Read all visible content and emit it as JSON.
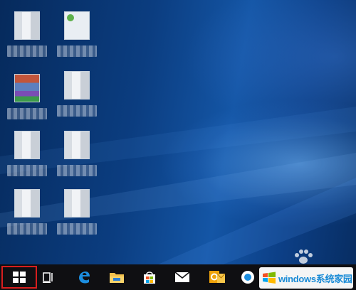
{
  "desktop": {
    "icons": [
      {
        "label": "",
        "style": "pix"
      },
      {
        "label": "",
        "style": "green"
      },
      {
        "label": "",
        "style": "colors"
      },
      {
        "label": "",
        "style": "pix"
      },
      {
        "label": "",
        "style": "pix"
      },
      {
        "label": "",
        "style": "pix"
      },
      {
        "label": "",
        "style": "pix"
      },
      {
        "label": "",
        "style": "pix"
      }
    ]
  },
  "taskbar": {
    "items": [
      "start",
      "task-view",
      "edge",
      "file-explorer",
      "store",
      "mail",
      "outlook",
      "app"
    ],
    "highlight_color": "#d81e1e"
  },
  "watermark": {
    "text": "windows系统家园"
  }
}
